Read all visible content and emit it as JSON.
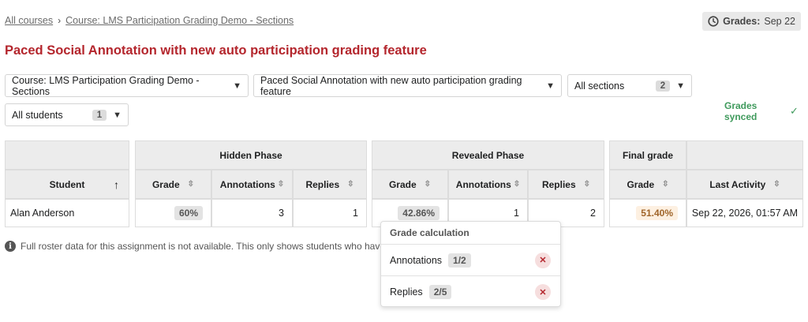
{
  "breadcrumb": {
    "item1": "All courses",
    "separator": "›",
    "item2": "Course: LMS Participation Grading Demo - Sections"
  },
  "grades_badge": {
    "label": "Grades:",
    "date": "Sep 22"
  },
  "page_title": "Paced Social Annotation with new auto participation grading feature",
  "filters": {
    "course": "Course: LMS Participation Grading Demo - Sections",
    "assignment": "Paced Social Annotation with new auto participation grading feature",
    "sections": {
      "label": "All sections",
      "count": "2"
    },
    "students": {
      "label": "All students",
      "count": "1"
    }
  },
  "sync_status": {
    "line1": "Grades",
    "line2": "synced",
    "check": "✓"
  },
  "table": {
    "groups": {
      "hidden": "Hidden Phase",
      "revealed": "Revealed Phase",
      "final": "Final grade"
    },
    "columns": {
      "student": "Student",
      "grade": "Grade",
      "annotations": "Annotations",
      "replies": "Replies",
      "last_activity": "Last Activity"
    },
    "sort_icons": {
      "asc": "↑",
      "sortable": "⇳"
    },
    "row": {
      "student": "Alan Anderson",
      "hidden_grade": "60%",
      "hidden_annotations": "3",
      "hidden_replies": "1",
      "revealed_grade": "42.86%",
      "revealed_annotations": "1",
      "revealed_replies": "2",
      "final_grade": "51.40%",
      "last_activity": "Sep 22, 2026, 01:57 AM"
    }
  },
  "roster_note": "Full roster data for this assignment is not available. This only shows students who have p",
  "grade_calculation": {
    "title": "Grade calculation",
    "rows": [
      {
        "label": "Annotations",
        "value": "1/2"
      },
      {
        "label": "Replies",
        "value": "2/5"
      }
    ]
  }
}
